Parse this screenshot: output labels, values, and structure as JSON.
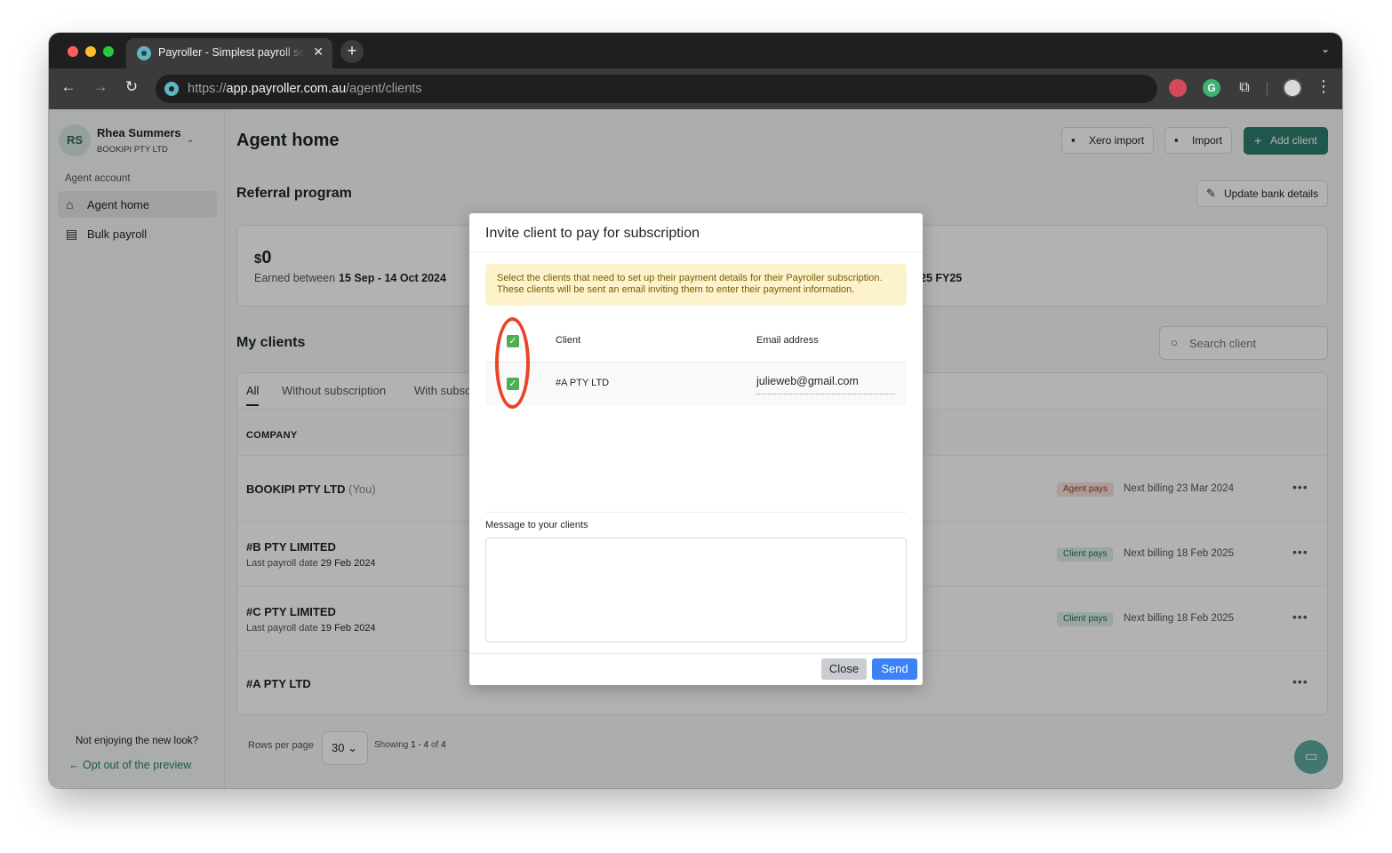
{
  "browser": {
    "tab_title": "Payroller - Simplest payroll so",
    "url_scheme": "https://",
    "url_host": "app.payroller.com.au",
    "url_path": "/agent/clients"
  },
  "sidebar": {
    "avatar_initials": "RS",
    "user_name": "Rhea Summers",
    "user_org": "BOOKIPI PTY LTD",
    "section": "Agent account",
    "items": [
      {
        "label": "Agent home"
      },
      {
        "label": "Bulk payroll"
      }
    ],
    "footer_question": "Not enjoying the new look?",
    "footer_link": "Opt out of the preview"
  },
  "header": {
    "title": "Agent home",
    "xero_import": "Xero import",
    "import": "Import",
    "add_client": "Add client"
  },
  "referral": {
    "title": "Referral program",
    "update_bank": "Update bank details",
    "currency": "$",
    "amount": "0",
    "earned_prefix": "Earned between",
    "earned_range": "15 Sep - 14 Oct  2024",
    "fy_fragment": "25 FY25"
  },
  "clients": {
    "title": "My clients",
    "search_placeholder": "Search client",
    "tabs": [
      "All",
      "Without subscription",
      "With subsc"
    ],
    "column_company": "COMPANY",
    "rows": [
      {
        "name": "BOOKIPI PTY LTD",
        "suffix": "(You)",
        "sub_label": "",
        "sub_value": "",
        "pill": "Agent pays",
        "billing": "Next billing 23 Mar 2024"
      },
      {
        "name": "#B PTY LIMITED",
        "suffix": "",
        "sub_label": "Last payroll date",
        "sub_value": "29 Feb 2024",
        "pill": "Client pays",
        "billing": "Next billing 18 Feb 2025"
      },
      {
        "name": "#C PTY LIMITED",
        "suffix": "",
        "sub_label": "Last payroll date",
        "sub_value": "19 Feb 2024",
        "pill": "Client pays",
        "billing": "Next billing 18 Feb 2025"
      },
      {
        "name": "#A PTY LTD",
        "suffix": "",
        "sub_label": "",
        "sub_value": "",
        "pill": "",
        "billing": ""
      }
    ],
    "rows_per_page_label": "Rows per page",
    "rows_per_page_value": "30",
    "showing_prefix": "Showing",
    "showing_range": "1 - 4",
    "showing_of": "of",
    "showing_total": "4"
  },
  "modal": {
    "title": "Invite client to pay for subscription",
    "alert_line1": "Select the clients that need to set up their payment details for their Payroller subscription.",
    "alert_line2": "These clients will be sent an email inviting them to enter their payment information.",
    "col_client": "Client",
    "col_email": "Email address",
    "row_client": "#A PTY LTD",
    "row_email": "julieweb@gmail.com",
    "message_label": "Message to your clients",
    "message_value": "",
    "close_label": "Close",
    "send_label": "Send"
  },
  "colors": {
    "brand_green": "#2f7d6e",
    "send_blue": "#3b82f6",
    "annotation_red": "#e8452a",
    "checkbox_green": "#4caf50"
  }
}
